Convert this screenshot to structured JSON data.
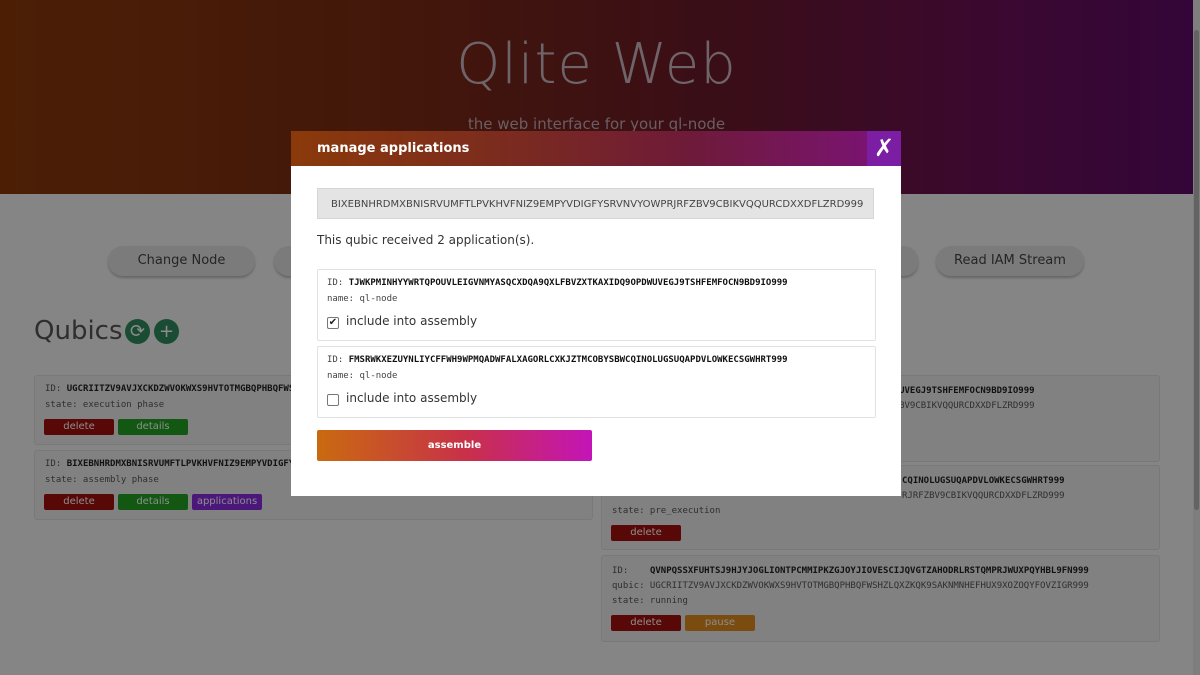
{
  "header": {
    "title": "Qlite Web",
    "subtitle": "the web interface for your ql-node"
  },
  "nav": {
    "change_node": "Change Node",
    "read_iam": "Read IAM Stream"
  },
  "qubics": {
    "title": "Qubics",
    "refresh_icon": "⟳",
    "add_icon": "+"
  },
  "left_cards": [
    {
      "id": "UGCRIITZV9AVJXCKDZWVOKWXS9HVTOTMGBQPHBQFWSHZLQ",
      "state": "state: execution phase",
      "btn1": "delete",
      "btn2": "details"
    },
    {
      "id": "BIXEBNHRDMXBNISRVUMFTLPVKHVFNIZ9EMPYVDIGFYSRVN",
      "state": "state: assembly phase",
      "btn1": "delete",
      "btn2": "details",
      "btn3": "applications"
    }
  ],
  "right_cards": [
    {
      "id_tail": "9OPDWUVEGJ9TSHFEMFOCN9BD9IO999",
      "qubic_tail": "RJRFZBV9CBIKVQQURCDXXDFLZRD999"
    },
    {
      "id_tail": "CQINOLUGSUQAPDVLOWKECSGWHRT999",
      "qubic_tail": "RJRFZBV9CBIKVQQURCDXXDFLZRD999",
      "state": "state: pre_execution",
      "btn1": "delete"
    },
    {
      "id_label": "ID:",
      "id": "QVNPQSSXFUHTSJ9HJYJOGLIONTPCMMIPKZGJOYJIOVESCIJQVGTZAHODRLRSTQMPRJWUXPQYHBL9FN999",
      "qubic": "qubic: UGCRIITZV9AVJXCKDZWVOKWXS9HVTOTMGBQPHBQFWSHZLQXZKQK9SAKNMNHEFHUX9XOZOQYFOVZIGR999",
      "state": "state: running",
      "btn1": "delete",
      "btn2": "pause"
    }
  ],
  "modal": {
    "title": "manage applications",
    "close_icon": "✗",
    "qubic_id": "BIXEBNHRDMXBNISRVUMFTLPVKHVFNIZ9EMPYVDIGFYSRVNVYOWPRJRFZBV9CBIKVQQURCDXXDFLZRD999",
    "received": "This qubic received 2 application(s).",
    "apps": [
      {
        "id_label": "ID:",
        "id": "TJWKPMINHYYWRTQPOUVLEIGVNMYASQCXDQA9QXLFBVZXTKAXIDQ9OPDWUVEGJ9TSHFEMFOCN9BD9IO999",
        "name": "name: ql-node",
        "checked": "✔",
        "label": "include into assembly"
      },
      {
        "id_label": "ID:",
        "id": "FMSRWKXEZUYNLIYCFFWH9WPMQADWFALXAGORLCXKJZTMCOBYSBWCQINOLUGSUQAPDVLOWKECSGWHRT999",
        "name": "name: ql-node",
        "checked": "",
        "label": "include into assembly"
      }
    ],
    "assemble": "assemble"
  }
}
